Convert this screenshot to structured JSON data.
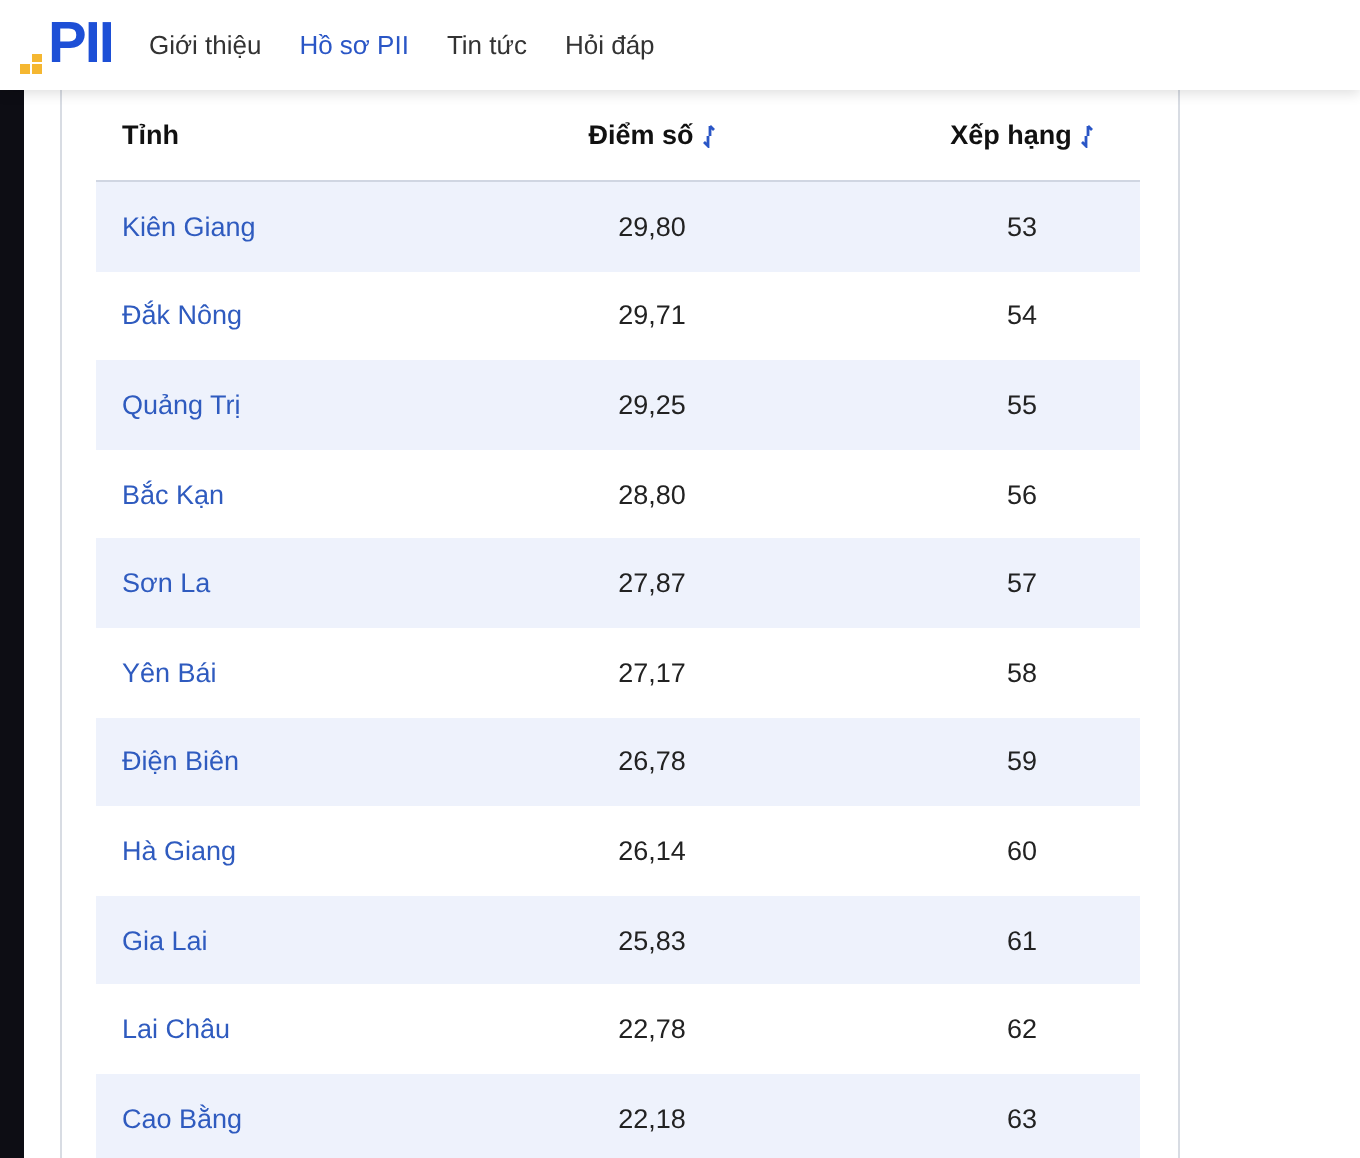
{
  "logo": {
    "text": "PII"
  },
  "nav": [
    {
      "label": "Giới thiệu",
      "selected": false
    },
    {
      "label": "Hồ sơ PII",
      "selected": true
    },
    {
      "label": "Tin tức",
      "selected": false
    },
    {
      "label": "Hỏi đáp",
      "selected": false
    }
  ],
  "table": {
    "columns": [
      {
        "label": "Tỉnh",
        "sortable": false
      },
      {
        "label": "Điểm số",
        "sortable": true
      },
      {
        "label": "Xếp hạng",
        "sortable": true
      }
    ],
    "rows": [
      {
        "province": "Kiên Giang",
        "score": "29,80",
        "rank": "53"
      },
      {
        "province": "Đắk Nông",
        "score": "29,71",
        "rank": "54"
      },
      {
        "province": "Quảng Trị",
        "score": "29,25",
        "rank": "55"
      },
      {
        "province": "Bắc Kạn",
        "score": "28,80",
        "rank": "56"
      },
      {
        "province": "Sơn La",
        "score": "27,87",
        "rank": "57"
      },
      {
        "province": "Yên Bái",
        "score": "27,17",
        "rank": "58"
      },
      {
        "province": "Điện Biên",
        "score": "26,78",
        "rank": "59"
      },
      {
        "province": "Hà Giang",
        "score": "26,14",
        "rank": "60"
      },
      {
        "province": "Gia Lai",
        "score": "25,83",
        "rank": "61"
      },
      {
        "province": "Lai Châu",
        "score": "22,78",
        "rank": "62"
      },
      {
        "province": "Cao Bằng",
        "score": "22,18",
        "rank": "63"
      }
    ]
  }
}
